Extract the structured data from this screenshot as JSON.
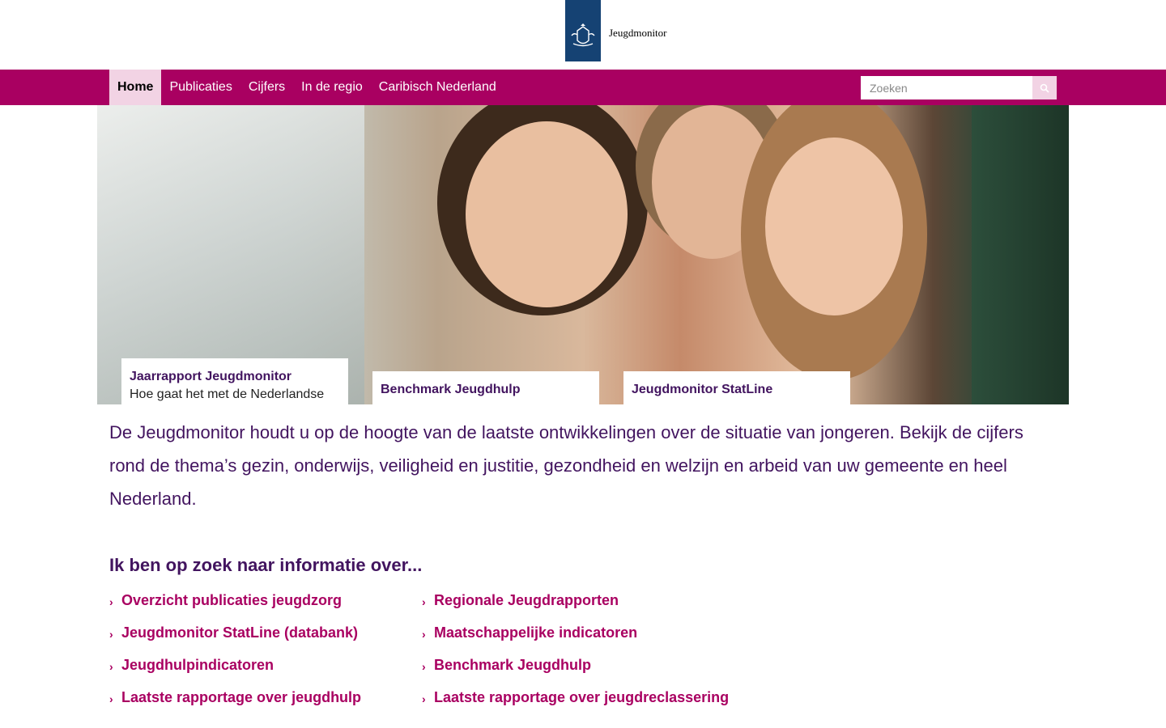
{
  "header": {
    "logo_text": "Jeugdmonitor"
  },
  "nav": {
    "items": [
      "Home",
      "Publicaties",
      "Cijfers",
      "In de regio",
      "Caribisch Nederland"
    ],
    "active": "Home"
  },
  "search": {
    "placeholder": "Zoeken"
  },
  "hero": {
    "cards": [
      {
        "title": "Jaarrapport Jeugdmonitor",
        "subtitle": "Hoe gaat het met de Nederlandse"
      },
      {
        "title": "Benchmark Jeugdhulp"
      },
      {
        "title": "Jeugdmonitor StatLine"
      }
    ]
  },
  "intro": "De Jeugdmonitor houdt u op de hoogte van de laatste ontwikkelingen over de situatie van jongeren. Bekijk de cijfers rond de thema’s gezin, onderwijs, veiligheid en justitie, gezondheid en welzijn en arbeid van uw gemeente en heel Nederland.",
  "section_title": "Ik ben op zoek naar informatie over...",
  "links": {
    "left": [
      "Overzicht publicaties jeugdzorg",
      "Jeugdmonitor StatLine (databank)",
      "Jeugdhulpindicatoren",
      "Laatste rapportage over jeugdhulp"
    ],
    "right": [
      "Regionale Jeugdrapporten",
      "Maatschappelijke indicatoren",
      "Benchmark Jeugdhulp",
      "Laatste rapportage over jeugdreclassering"
    ]
  },
  "colors": {
    "brand": "#a90061",
    "primary_text": "#42145f",
    "logo_blue": "#154273",
    "active_nav_bg": "#f2d3e4"
  },
  "icons": {
    "search": "search-icon",
    "link_arrow": "chevron-right-icon",
    "logo": "crest-icon"
  }
}
